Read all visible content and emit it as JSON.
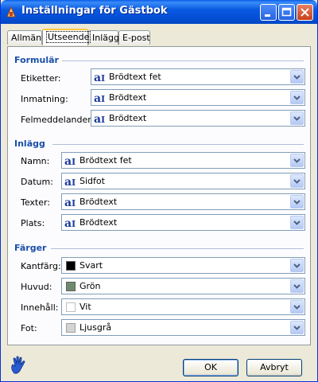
{
  "window": {
    "title": "Inställningar för Gästbok"
  },
  "tabs": [
    {
      "label": "Allmänt",
      "active": false
    },
    {
      "label": "Utseende",
      "active": true
    },
    {
      "label": "Inlägg",
      "active": false
    },
    {
      "label": "E-post",
      "active": false
    }
  ],
  "form": {
    "title": "Formulär",
    "rows": [
      {
        "label": "Etiketter:",
        "value": "Brödtext fet"
      },
      {
        "label": "Inmatning:",
        "value": "Brödtext"
      },
      {
        "label": "Felmeddelanden:",
        "value": "Brödtext"
      }
    ]
  },
  "posts": {
    "title": "Inlägg",
    "rows": [
      {
        "label": "Namn:",
        "value": "Brödtext fet"
      },
      {
        "label": "Datum:",
        "value": "Sidfot"
      },
      {
        "label": "Texter:",
        "value": "Brödtext"
      },
      {
        "label": "Plats:",
        "value": "Brödtext"
      }
    ]
  },
  "colors": {
    "title": "Färger",
    "rows": [
      {
        "label": "Kantfärg:",
        "value": "Svart",
        "swatch": "#000000"
      },
      {
        "label": "Huvud:",
        "value": "Grön",
        "swatch": "#6e8a6e"
      },
      {
        "label": "Innehåll:",
        "value": "Vit",
        "swatch": "#ffffff"
      },
      {
        "label": "Fot:",
        "value": "Ljusgrå",
        "swatch": "#d4d4d4"
      }
    ]
  },
  "buttons": {
    "ok": "OK",
    "cancel": "Avbryt"
  }
}
